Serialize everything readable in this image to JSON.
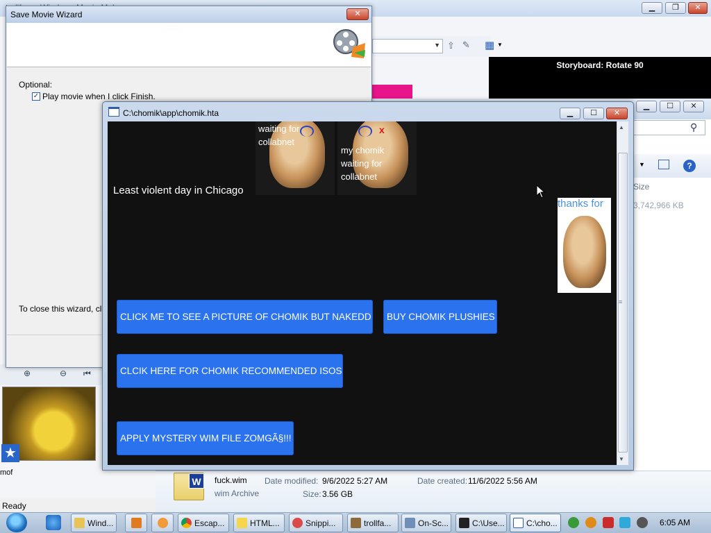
{
  "movie_maker": {
    "title": "trollfa... - Windows Movie Maker",
    "storyboard_label": "Storyboard: Rotate 90",
    "status": "Ready",
    "clip_label": "mof",
    "colors": {
      "preview_bg": "#000000",
      "pink_clip": "#e8158a"
    }
  },
  "explorer": {
    "column_size": "Size",
    "row_size_partial": "3,742,966 KB",
    "details": {
      "file_name": "fuck.wim",
      "file_type": "wim Archive",
      "date_modified_label": "Date modified:",
      "date_modified_value": "9/6/2022 5:27 AM",
      "date_created_label": "Date created:",
      "date_created_value": "11/6/2022 5:56 AM",
      "size_label": "Size:",
      "size_value": "3.56 GB"
    }
  },
  "wizard": {
    "title": "Save Movie Wizard",
    "optional_label": "Optional:",
    "checkbox_label": "Play movie when I click Finish.",
    "checkbox_checked": "✓",
    "close_note": "To close this wizard, click"
  },
  "hta": {
    "title": "C:\\chomik\\app\\chomik.hta",
    "caption_1": "waiting for collabnet",
    "caption_2": "my chomik waiting for collabnet",
    "chicago_text": "Least violent day in Chicago",
    "thanks_text": "thanks for",
    "buttons": {
      "naked": "CLICK ME TO SEE A PICTURE OF CHOMIK BUT NAKEDD",
      "plushies": "BUY CHOMIK PLUSHIES",
      "isos": "CLCIK HERE FOR CHOMIK RECOMMENDED ISOS",
      "wim": "APPLY MYSTERY WIM FILE ZOMGÃ§!!!"
    },
    "colors": {
      "bg": "#111111",
      "button": "#2b72ee",
      "thanks": "#4a90e2"
    }
  },
  "taskbar": {
    "items": [
      {
        "label": "Wind...",
        "icon": "folder-icon"
      },
      {
        "label": "",
        "icon": "media-player-icon"
      },
      {
        "label": "",
        "icon": "paint-icon"
      },
      {
        "label": "Escap...",
        "icon": "chrome-icon"
      },
      {
        "label": "HTML...",
        "icon": "help-icon"
      },
      {
        "label": "Snippi...",
        "icon": "snipping-icon"
      },
      {
        "label": "trollfa...",
        "icon": "movie-maker-icon"
      },
      {
        "label": "On-Sc...",
        "icon": "keyboard-icon"
      },
      {
        "label": "C:\\Use...",
        "icon": "7zip-icon"
      },
      {
        "label": "C:\\cho...",
        "icon": "hta-icon"
      }
    ],
    "clock": "6:05 AM"
  }
}
